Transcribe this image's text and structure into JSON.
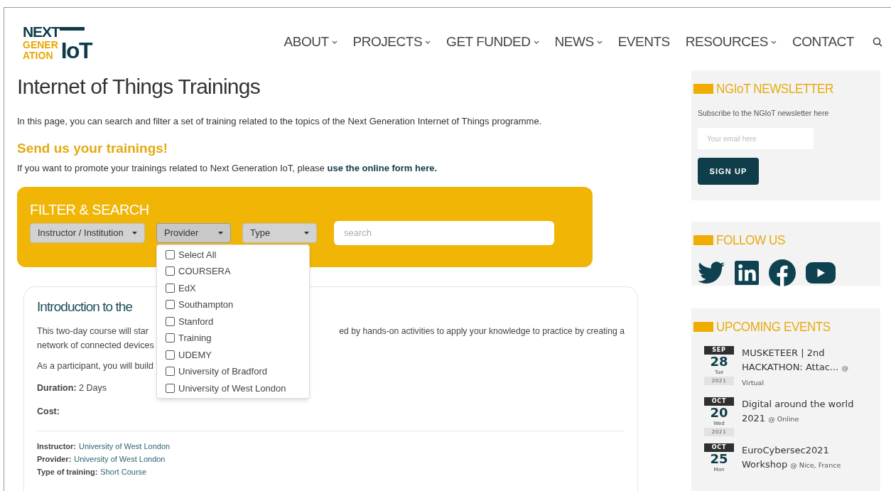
{
  "logo": {
    "lines": [
      "NEXT",
      "GENER",
      "ATION"
    ],
    "mark": "IoT"
  },
  "nav": [
    {
      "label": "ABOUT",
      "has_menu": true
    },
    {
      "label": "PROJECTS",
      "has_menu": true
    },
    {
      "label": "GET FUNDED",
      "has_menu": true
    },
    {
      "label": "NEWS",
      "has_menu": true
    },
    {
      "label": "EVENTS",
      "has_menu": false
    },
    {
      "label": "RESOURCES",
      "has_menu": true
    },
    {
      "label": "CONTACT",
      "has_menu": false
    }
  ],
  "page": {
    "title": "Internet of Things Trainings",
    "intro": "In this page, you can search and filter a set of training related to the topics of the Next Generation Internet of Things programme.",
    "subtitle": "Send us your trainings!",
    "promo": "If you want to promote your trainings related to Next Generation IoT, please",
    "promo_link": "use the online form here."
  },
  "filter": {
    "title": "FILTER & SEARCH",
    "dropdowns": [
      {
        "label": "Instructor / Institution",
        "open": false
      },
      {
        "label": "Provider",
        "open": true
      },
      {
        "label": "Type",
        "open": false
      }
    ],
    "search": {
      "placeholder": "search"
    },
    "options": [
      {
        "label": "Select All",
        "checked": false
      },
      {
        "label": "COURSERA",
        "checked": false
      },
      {
        "label": "EdX",
        "checked": false
      },
      {
        "label": "Southampton",
        "checked": false
      },
      {
        "label": "Stanford",
        "checked": false
      },
      {
        "label": "Training",
        "checked": false
      },
      {
        "label": "UDEMY",
        "checked": false
      },
      {
        "label": "University of Bradford",
        "checked": false
      },
      {
        "label": "University of West London",
        "checked": false
      }
    ]
  },
  "card": {
    "title": "Introduction to the",
    "line1_left": "This two-day course will star",
    "line1_right": "ed by hands-on activities to apply your knowledge to practice by creating a",
    "line2": "network of connected devices",
    "line3": "As a participant, you will build",
    "duration_label": "Duration:",
    "duration": "2 Days",
    "cost_label": "Cost:",
    "meta": [
      {
        "label": "Instructor:",
        "value": "University of West London"
      },
      {
        "label": "Provider:",
        "value": "University of West London"
      },
      {
        "label": "Type of training:",
        "value": "Short Course"
      }
    ]
  },
  "newsletter": {
    "title": "NGIoT NEWSLETTER",
    "text": "Subscribe to the NGIoT newsletter here",
    "email": {
      "placeholder": "Your email here"
    },
    "button": "SIGN UP"
  },
  "follow": {
    "title": "FOLLOW US",
    "icons": [
      {
        "kind": "twitter"
      },
      {
        "kind": "linkedin"
      },
      {
        "kind": "facebook"
      },
      {
        "kind": "youtube"
      }
    ]
  },
  "events": {
    "title": "UPCOMING EVENTS",
    "items": [
      {
        "month": "SEP",
        "day": "28",
        "weekday": "Tue",
        "year": "2021",
        "name": "MUSKETEER | 2nd HACKATHON: Attac...",
        "place": "@ Virtual"
      },
      {
        "month": "OCT",
        "day": "20",
        "weekday": "Wed",
        "year": "2021",
        "name": "Digital around the world 2021",
        "place": "@ Online"
      },
      {
        "month": "OCT",
        "day": "25",
        "weekday": "Mon",
        "name": "EuroCybersec2021 Workshop",
        "place": "@ Nice, France"
      }
    ]
  }
}
